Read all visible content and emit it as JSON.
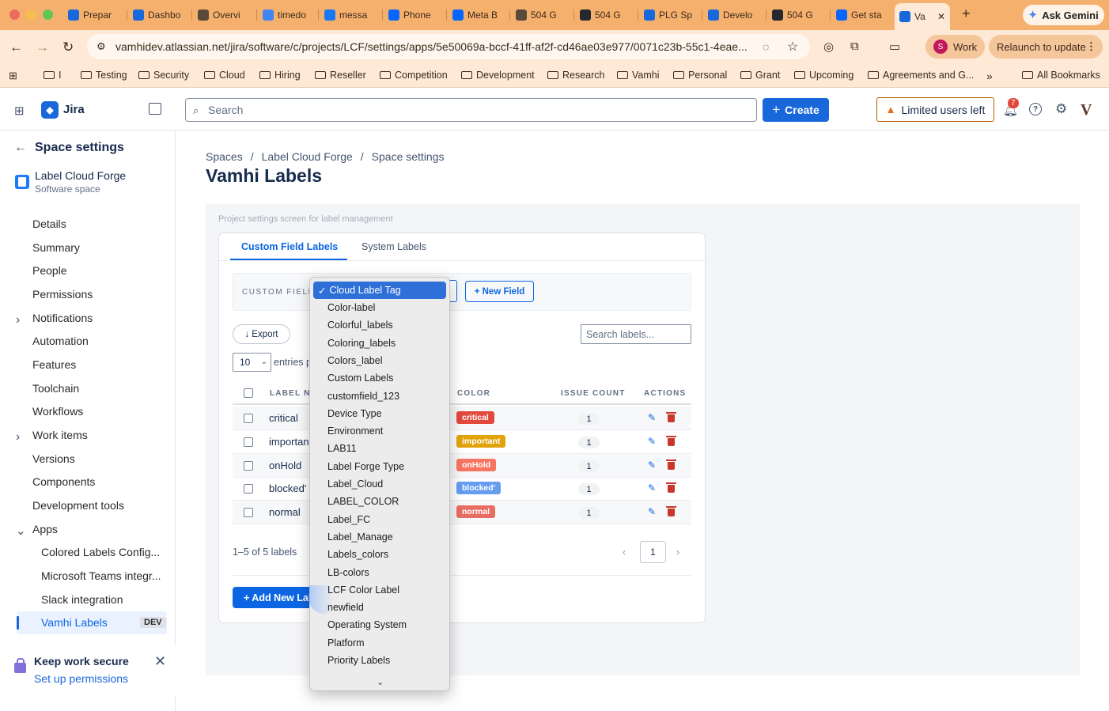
{
  "browser": {
    "tabs": [
      {
        "label": "Prepar",
        "icon": "jira-icon",
        "color": "#1868db"
      },
      {
        "label": "Dashbo",
        "icon": "jira-icon",
        "color": "#1868db"
      },
      {
        "label": "Overvi",
        "icon": "folder-icon",
        "color": "#5a4a3a"
      },
      {
        "label": "timedo",
        "icon": "google-icon",
        "color": "#4285f4"
      },
      {
        "label": "messa",
        "icon": "facebook-icon",
        "color": "#1877f2"
      },
      {
        "label": "Phone",
        "icon": "meta-icon",
        "color": "#0866ff"
      },
      {
        "label": "Meta B",
        "icon": "meta-icon",
        "color": "#0866ff"
      },
      {
        "label": "504 G",
        "icon": "globe-icon",
        "color": "#5a4a3a"
      },
      {
        "label": "504 G",
        "icon": "github-icon",
        "color": "#24292f"
      },
      {
        "label": "PLG Sp",
        "icon": "jira-icon",
        "color": "#1868db"
      },
      {
        "label": "Develo",
        "icon": "atlassian-icon",
        "color": "#1868db"
      },
      {
        "label": "504 G",
        "icon": "github-icon",
        "color": "#24292f"
      },
      {
        "label": "Get sta",
        "icon": "meta-icon",
        "color": "#0866ff"
      },
      {
        "label": "Va",
        "icon": "jira-icon",
        "color": "#1868db"
      }
    ],
    "new_tab": "+",
    "gemini_label": "Ask Gemini",
    "url": "vamhidev.atlassian.net/jira/software/c/projects/LCF/settings/apps/5e50069a-bccf-41ff-af2f-cd46ae03e977/0071c23b-55c1-4eae...",
    "profile_label": "Work",
    "profile_initial": "S",
    "relaunch_label": "Relaunch to update",
    "bookmarks": [
      "I",
      "Testing",
      "Security",
      "Cloud",
      "Hiring",
      "Reseller",
      "Competition",
      "Development",
      "Research",
      "Vamhi",
      "Personal",
      "Grant",
      "Upcoming",
      "Agreements and G..."
    ],
    "all_bookmarks": "All Bookmarks"
  },
  "jira": {
    "app_name": "Jira",
    "search_placeholder": "Search",
    "create_label": "Create",
    "limited_label": "Limited users left",
    "notif_count": "7"
  },
  "sidebar": {
    "title": "Space settings",
    "project_name": "Label Cloud Forge",
    "project_type": "Software space",
    "items": [
      "Details",
      "Summary",
      "People",
      "Permissions",
      "Notifications",
      "Automation",
      "Features",
      "Toolchain",
      "Workflows",
      "Work items",
      "Versions",
      "Components",
      "Development tools",
      "Apps"
    ],
    "apps": [
      "Colored Labels Config...",
      "Microsoft Teams integr...",
      "Slack integration",
      "Vamhi Labels"
    ],
    "dev_badge": "DEV",
    "secure_title": "Keep work secure",
    "secure_link": "Set up permissions"
  },
  "main": {
    "breadcrumbs": [
      "Spaces",
      "Label Cloud Forge",
      "Space settings"
    ],
    "title": "Vamhi Labels",
    "caption": "Project settings screen for label management",
    "tabs": [
      "Custom Field Labels",
      "System Labels"
    ],
    "custom_field_label": "CUSTOM FIELD:",
    "new_field_label": "+ New Field",
    "export_label": "Export",
    "search_labels_placeholder": "Search labels...",
    "entries_value": "10",
    "entries_text": "entries p",
    "columns": [
      "LABEL NA",
      "COLOR",
      "ISSUE COUNT",
      "ACTIONS"
    ],
    "rows": [
      {
        "name": "critical",
        "color_label": "critical",
        "color": "#e2483d",
        "count": "1"
      },
      {
        "name": "importan",
        "color_label": "important",
        "color": "#e2a30a",
        "count": "1"
      },
      {
        "name": "onHold",
        "color_label": "onHold",
        "color": "#f87462",
        "count": "1"
      },
      {
        "name": "blocked'",
        "color_label": "blocked'",
        "color": "#669df1",
        "count": "1"
      },
      {
        "name": "normal",
        "color_label": "normal",
        "color": "#e86e63",
        "count": "1"
      }
    ],
    "range_text": "1–5 of 5 labels",
    "page": "1",
    "add_label": "+ Add New Lal"
  },
  "dropdown": {
    "selected": "Cloud Label Tag",
    "options": [
      "Color-label",
      "Colorful_labels",
      "Coloring_labels",
      "Colors_label",
      "Custom Labels",
      "customfield_123",
      "Device Type",
      "Environment",
      "LAB11",
      "Label Forge Type",
      "Label_Cloud",
      "LABEL_COLOR",
      "Label_FC",
      "Label_Manage",
      "Labels_colors",
      "LB-colors",
      "LCF Color Label",
      "newfield",
      "Operating System",
      "Platform",
      "Priority Labels"
    ]
  }
}
